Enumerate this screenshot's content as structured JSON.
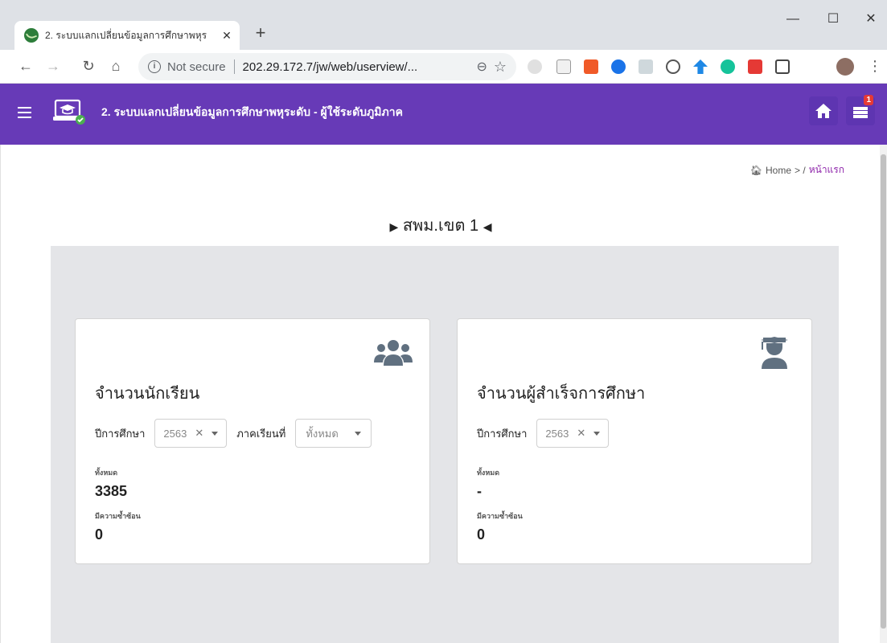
{
  "browser": {
    "tab_title": "2. ระบบแลกเปลี่ยนข้อมูลการศึกษาพหุร",
    "tab_close": "✕",
    "new_tab": "+",
    "minimize": "—",
    "maximize": "☐",
    "close": "✕",
    "security_label": "Not secure",
    "url": "202.29.172.7/jw/web/userview/..."
  },
  "header": {
    "title": "2. ระบบแลกเปลี่ยนข้อมูลการศึกษาพหุระดับ - ผู้ใช้ระดับภูมิภาค",
    "notification_count": "1",
    "color": "#673ab7"
  },
  "breadcrumb": {
    "home": "Home",
    "separator": "> /",
    "current": "หน้าแรก"
  },
  "section_title": "สพม.เขต 1",
  "cards": [
    {
      "icon": "users-icon",
      "title": "จำนวนนักเรียน",
      "year_label": "ปีการศึกษา",
      "year_value": "2563",
      "term_label": "ภาคเรียนที่",
      "term_value": "ทั้งหมด",
      "total_label": "ทั้งหมด",
      "total_value": "3385",
      "dup_label": "มีความซ้ำซ้อน",
      "dup_value": "0"
    },
    {
      "icon": "graduate-icon",
      "title": "จำนวนผู้สำเร็จการศึกษา",
      "year_label": "ปีการศึกษา",
      "year_value": "2563",
      "total_label": "ทั้งหมด",
      "total_value": "-",
      "dup_label": "มีความซ้ำซ้อน",
      "dup_value": "0"
    }
  ]
}
